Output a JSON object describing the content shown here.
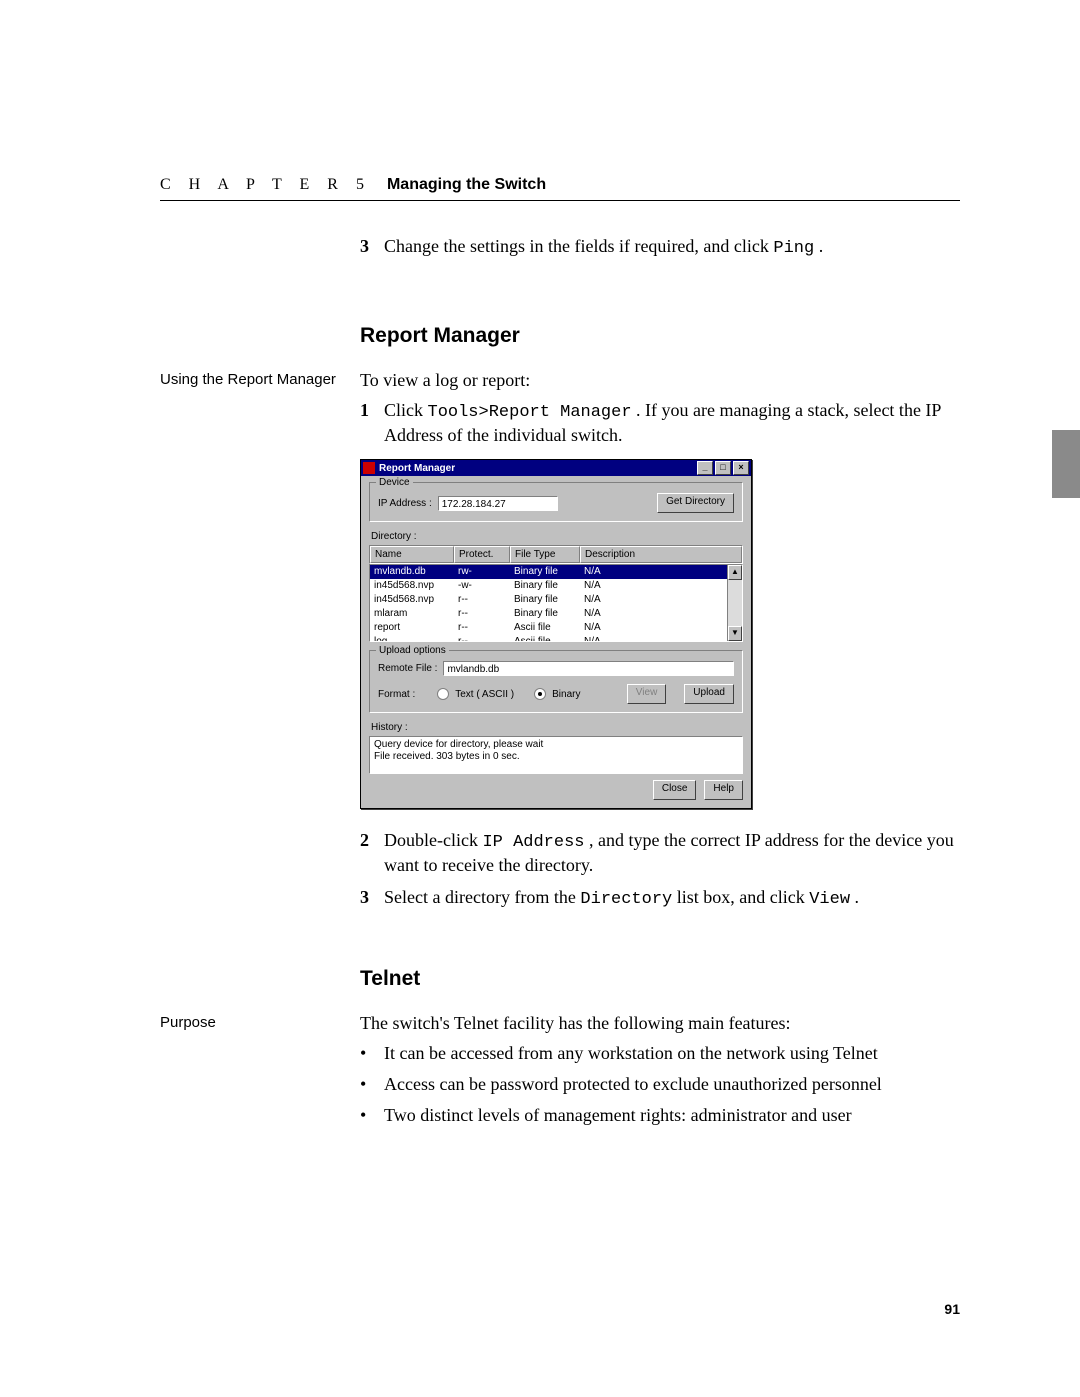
{
  "header": {
    "chapter": "C H A P T E R 5",
    "title": "Managing the Switch"
  },
  "step3": {
    "num": "3",
    "before": " Change the settings in the fields if required, and click ",
    "code": "Ping",
    "after": "."
  },
  "rm": {
    "heading": "Report Manager",
    "side": "Using the Report Manager",
    "intro": "To view a log or report:",
    "s1": {
      "num": "1",
      "a": " Click ",
      "code": "Tools>Report Manager",
      "b": ". If you are managing a stack, select the IP Address of the individual switch."
    },
    "s2": {
      "num": "2",
      "a": " Double-click ",
      "code": "IP Address",
      "b": ", and type the correct IP address for the device you want to receive the directory."
    },
    "s3": {
      "num": "3",
      "a": " Select a directory from the ",
      "code1": "Directory",
      "b": " list box, and click ",
      "code2": "View",
      "c": "."
    }
  },
  "telnet": {
    "heading": "Telnet",
    "side": "Purpose",
    "intro": "The switch's Telnet facility has the following main features:",
    "b1": "It can be accessed from any workstation on the network using Telnet",
    "b2": "Access can be password protected to exclude unauthorized personnel",
    "b3": "Two distinct levels of management rights: administrator and user"
  },
  "page_number": "91",
  "dlg": {
    "title": "Report Manager",
    "device": {
      "legend": "Device",
      "ip_label": "IP Address :",
      "ip_value": "172.28.184.27",
      "getdir": "Get Directory"
    },
    "dir_label": "Directory :",
    "cols": {
      "name": "Name",
      "protect": "Protect.",
      "type": "File Type",
      "desc": "Description"
    },
    "rows": [
      {
        "name": "mvlandb.db",
        "protect": "rw-",
        "type": "Binary file",
        "desc": "N/A"
      },
      {
        "name": "in45d568.nvp",
        "protect": "-w-",
        "type": "Binary file",
        "desc": "N/A"
      },
      {
        "name": "in45d568.nvp",
        "protect": "r--",
        "type": "Binary file",
        "desc": "N/A"
      },
      {
        "name": "mlaram",
        "protect": "r--",
        "type": "Binary file",
        "desc": "N/A"
      },
      {
        "name": "report",
        "protect": "r--",
        "type": "Ascii file",
        "desc": "N/A"
      },
      {
        "name": "log",
        "protect": "r--",
        "type": "Ascii file",
        "desc": "N/A"
      }
    ],
    "uo": {
      "legend": "Upload options",
      "remote_label": "Remote File :",
      "remote_value": "mvlandb.db",
      "format_label": "Format :",
      "r_text": "Text ( ASCII )",
      "r_bin": "Binary",
      "view": "View",
      "upload": "Upload"
    },
    "history_label": "History :",
    "history_lines": {
      "l1": "Query device for directory, please wait",
      "l2": "File received. 303 bytes in 0 sec."
    },
    "close": "Close",
    "help": "Help"
  }
}
